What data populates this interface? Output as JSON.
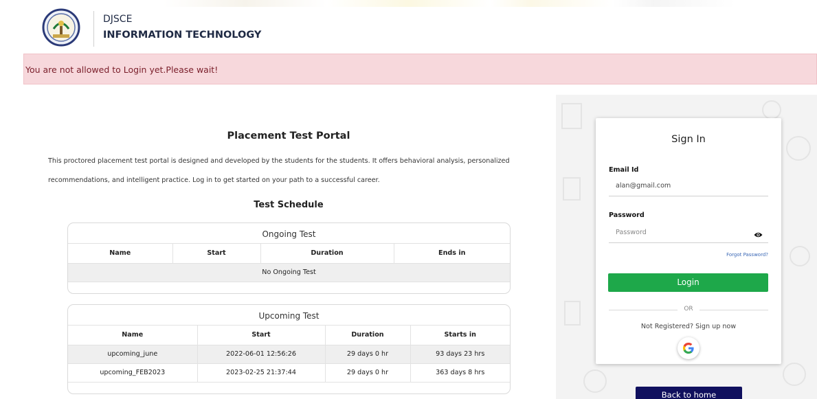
{
  "header": {
    "college": "DJSCE",
    "department": "INFORMATION TECHNOLOGY",
    "logo_icon": "college-crest-icon"
  },
  "alert": {
    "message": "You are not allowed to Login yet.Please wait!",
    "bg_color": "#f7d8dc"
  },
  "main": {
    "title": "Placement Test Portal",
    "description": "This proctored placement test portal is designed and developed by the students for the students. It offers behavioral analysis, personalized recommendations, and intelligent practice. Log in to get started on your path to a successful career.",
    "schedule_title": "Test Schedule"
  },
  "ongoing": {
    "title": "Ongoing Test",
    "columns": [
      "Name",
      "Start",
      "Duration",
      "Ends in"
    ],
    "empty_text": "No Ongoing Test"
  },
  "upcoming": {
    "title": "Upcoming Test",
    "columns": [
      "Name",
      "Start",
      "Duration",
      "Starts in"
    ],
    "rows": [
      [
        "upcoming_june",
        "2022-06-01 12:56:26",
        "29 days 0 hr",
        "93 days 23 hrs"
      ],
      [
        "upcoming_FEB2023",
        "2023-02-25 21:37:44",
        "29 days 0 hr",
        "363 days 8 hrs"
      ]
    ]
  },
  "signin": {
    "title": "Sign In",
    "email_label": "Email Id",
    "email_value": "alan@gmail.com",
    "password_label": "Password",
    "password_placeholder": "Password",
    "show_password_icon": "eye-icon",
    "forgot_label": "Forgot Password?",
    "login_label": "Login",
    "login_color": "#1ea84a",
    "or_label": "OR",
    "signup_text": "Not Registered? Sign up now",
    "google_icon": "google-icon"
  },
  "footer": {
    "back_home_label": "Back to home",
    "back_home_color": "#10105e"
  }
}
